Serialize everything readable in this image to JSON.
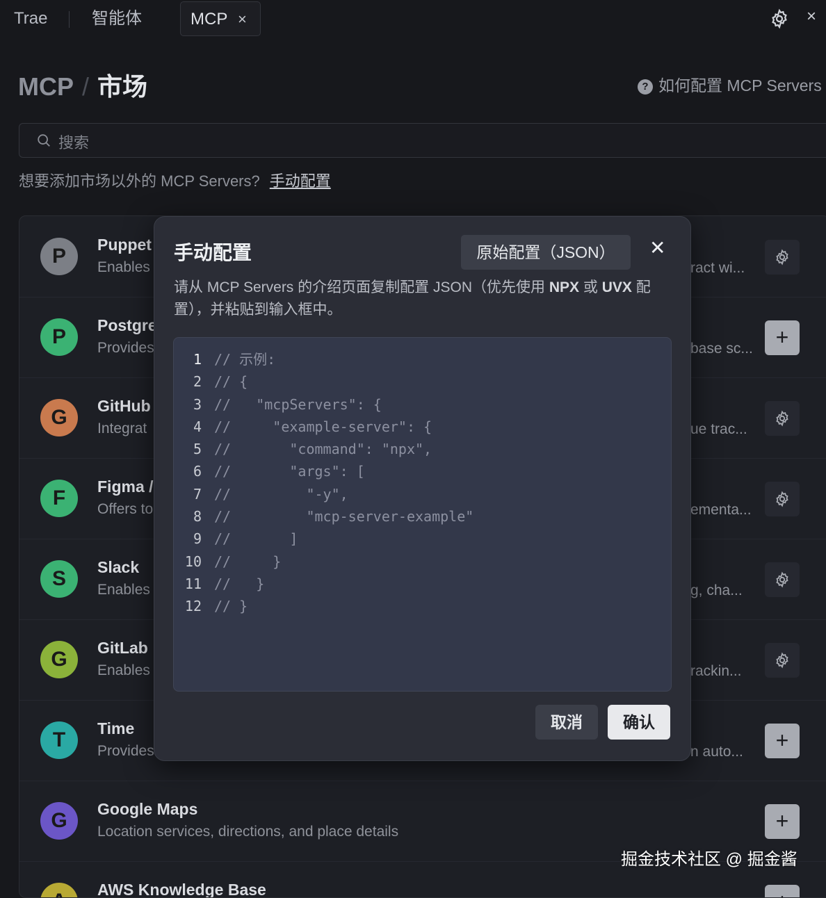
{
  "tabs": {
    "trae": "Trae",
    "agent": "智能体",
    "mcp": "MCP",
    "close_glyph": "×"
  },
  "top_right": {
    "close_glyph": "×"
  },
  "header": {
    "crumb": "MCP",
    "separator": "/",
    "title": "市场",
    "help_link": "如何配置 MCP Servers",
    "help_icon_glyph": "?"
  },
  "search": {
    "placeholder": "搜索"
  },
  "hint": {
    "text": "想要添加市场以外的 MCP Servers?",
    "link": "手动配置"
  },
  "servers": [
    {
      "letter": "P",
      "name": "Puppet",
      "desc": "Enables",
      "tail": "ract wi...",
      "action": "gear",
      "color": "#7c7f86"
    },
    {
      "letter": "P",
      "name": "Postgre",
      "desc": "Provides",
      "tail": "base sc...",
      "action": "plus",
      "color": "#3bb273"
    },
    {
      "letter": "G",
      "name": "GitHub",
      "desc": "Integrat",
      "tail": "ue trac...",
      "action": "gear",
      "color": "#c97a4e"
    },
    {
      "letter": "F",
      "name": "Figma /",
      "desc": "Offers to",
      "tail": "ementa...",
      "action": "gear",
      "color": "#3bb273"
    },
    {
      "letter": "S",
      "name": "Slack",
      "desc": "Enables",
      "tail": "g, cha...",
      "action": "gear",
      "color": "#3bb273"
    },
    {
      "letter": "G",
      "name": "GitLab",
      "desc": "Enables",
      "tail": "rackin...",
      "action": "gear",
      "color": "#8bb23a"
    },
    {
      "letter": "T",
      "name": "Time",
      "desc": "Provides",
      "tail": "n auto...",
      "action": "plus",
      "color": "#2aa9a4"
    },
    {
      "letter": "G",
      "name": "Google Maps",
      "desc": "Location services, directions, and place details",
      "tail": "",
      "action": "plus",
      "color": "#6b56c7"
    },
    {
      "letter": "A",
      "name": "AWS Knowledge Base",
      "desc": "",
      "tail": "",
      "action": "plus",
      "color": "#b8a934"
    }
  ],
  "modal": {
    "title": "手动配置",
    "raw_button": "原始配置（JSON）",
    "close_glyph": "✕",
    "desc_a": "请从 MCP Servers 的介绍页面复制配置 JSON（优先使用 ",
    "desc_npx": "NPX",
    "desc_b": " 或 ",
    "desc_uvx": "UVX",
    "desc_c": " 配置），并粘贴到输入框中。",
    "code_lines": [
      "// 示例:",
      "// {",
      "//   \"mcpServers\": {",
      "//     \"example-server\": {",
      "//       \"command\": \"npx\",",
      "//       \"args\": [",
      "//         \"-y\",",
      "//         \"mcp-server-example\"",
      "//       ]",
      "//     }",
      "//   }",
      "// }"
    ],
    "cancel": "取消",
    "confirm": "确认"
  },
  "watermark": "掘金技术社区 @ 掘金酱"
}
